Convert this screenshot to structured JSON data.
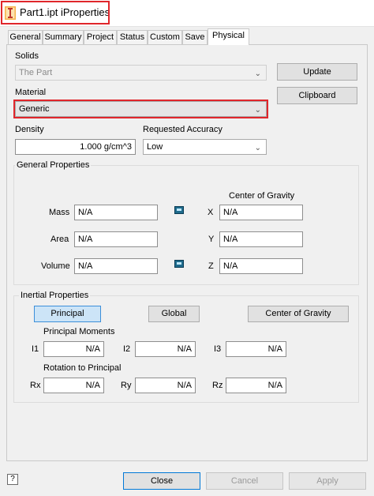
{
  "window": {
    "title": "Part1.ipt iProperties"
  },
  "tabs": [
    {
      "label": "General"
    },
    {
      "label": "Summary"
    },
    {
      "label": "Project"
    },
    {
      "label": "Status"
    },
    {
      "label": "Custom"
    },
    {
      "label": "Save"
    },
    {
      "label": "Physical",
      "active": true
    }
  ],
  "solids": {
    "label": "Solids",
    "value": "The Part"
  },
  "material": {
    "label": "Material",
    "value": "Generic"
  },
  "buttons": {
    "update": "Update",
    "clipboard": "Clipboard",
    "close": "Close",
    "cancel": "Cancel",
    "apply": "Apply"
  },
  "density": {
    "label": "Density",
    "value": "1.000 g/cm^3"
  },
  "accuracy": {
    "label": "Requested Accuracy",
    "value": "Low"
  },
  "general_properties": {
    "label": "General Properties",
    "center_of_gravity_label": "Center of Gravity",
    "mass": {
      "label": "Mass",
      "value": "N/A"
    },
    "area": {
      "label": "Area",
      "value": "N/A"
    },
    "volume": {
      "label": "Volume",
      "value": "N/A"
    },
    "x": {
      "label": "X",
      "value": "N/A"
    },
    "y": {
      "label": "Y",
      "value": "N/A"
    },
    "z": {
      "label": "Z",
      "value": "N/A"
    }
  },
  "inertial_properties": {
    "label": "Inertial Properties",
    "modes": {
      "principal": "Principal",
      "global": "Global",
      "center_of_gravity": "Center of Gravity"
    },
    "principal_moments_label": "Principal Moments",
    "i1": {
      "label": "I1",
      "value": "N/A"
    },
    "i2": {
      "label": "I2",
      "value": "N/A"
    },
    "i3": {
      "label": "I3",
      "value": "N/A"
    },
    "rotation_label": "Rotation to Principal",
    "rx": {
      "label": "Rx",
      "value": "N/A"
    },
    "ry": {
      "label": "Ry",
      "value": "N/A"
    },
    "rz": {
      "label": "Rz",
      "value": "N/A"
    }
  },
  "icons": {
    "app": "inventor-part-icon",
    "calc": "calculator-icon",
    "help": "help-icon",
    "dropdown": "chevron-down-icon"
  },
  "colors": {
    "highlight": "#e0262b",
    "accent": "#0078d7",
    "pressed": "#cce4f7"
  }
}
